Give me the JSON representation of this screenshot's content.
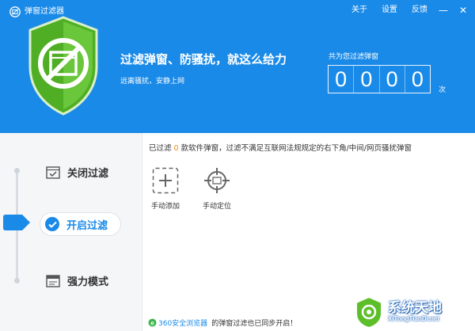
{
  "app": {
    "title": "弹窗过滤器"
  },
  "topnav": [
    {
      "label": "关于"
    },
    {
      "label": "设置"
    },
    {
      "label": "反馈"
    }
  ],
  "window_controls": {
    "minimize": "—",
    "close": "✕"
  },
  "hero": {
    "headline": "过滤弹窗、防骚扰，就这么给力",
    "subline": "远离骚扰，安静上网"
  },
  "counter": {
    "label": "共为您过滤弹窗",
    "digits": [
      "0",
      "0",
      "0",
      "0"
    ],
    "unit": "次"
  },
  "modes": [
    {
      "label": "关闭过滤"
    },
    {
      "label": "开启过滤",
      "active": true
    },
    {
      "label": "强力模式"
    }
  ],
  "status": {
    "prefix": "已过滤",
    "count": "0",
    "suffix": "款软件弹窗，过滤不满足互联网法规规定的右下角/中间/网页骚扰弹窗"
  },
  "tools": [
    {
      "label": "手动添加",
      "icon": "plus-in-dashed-box-icon"
    },
    {
      "label": "手动定位",
      "icon": "crosshair-target-icon"
    }
  ],
  "footer": {
    "browser_link": "360安全浏览器",
    "message": "的弹窗过滤也已同步开启！"
  },
  "watermark": {
    "text": "系统天地",
    "url": "XiTongTianDi.net"
  },
  "colors": {
    "header_blue": "#1a8ae8",
    "shield_green": "#5cbf2a",
    "accent_orange": "#f08c1a",
    "active_blue": "#1a8ae8"
  }
}
